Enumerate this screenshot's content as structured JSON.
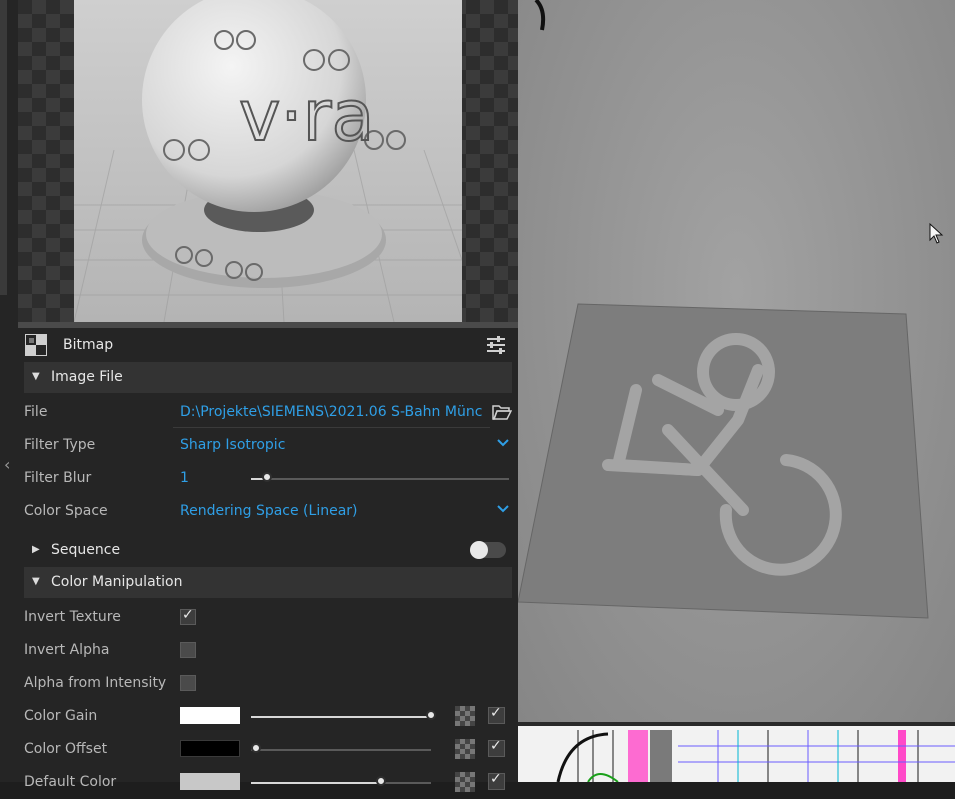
{
  "panel": {
    "title": "Bitmap",
    "sections": {
      "image_file": "Image File",
      "sequence": "Sequence",
      "color_manipulation": "Color Manipulation"
    },
    "image_file": {
      "file_label": "File",
      "file_value": "D:\\Projekte\\SIEMENS\\2021.06 S-Bahn Münc...",
      "filter_type_label": "Filter Type",
      "filter_type_value": "Sharp Isotropic",
      "filter_blur_label": "Filter Blur",
      "filter_blur_value": "1",
      "color_space_label": "Color Space",
      "color_space_value": "Rendering Space (Linear)"
    },
    "color_manipulation": {
      "invert_texture_label": "Invert Texture",
      "invert_texture": true,
      "invert_alpha_label": "Invert Alpha",
      "invert_alpha": false,
      "alpha_from_intensity_label": "Alpha from Intensity",
      "alpha_from_intensity": false,
      "color_gain_label": "Color Gain",
      "color_gain_swatch": "#ffffff",
      "color_gain_level": 1.0,
      "color_offset_label": "Color Offset",
      "color_offset_swatch": "#000000",
      "color_offset_level": 0.0,
      "default_color_label": "Default Color",
      "default_color_swatch": "#c8c8c8",
      "default_color_level": 0.7
    },
    "sequence_enabled": false
  },
  "preview": {
    "logo_text": "v·ra"
  },
  "colors": {
    "accent": "#2f9fe6",
    "panel_bg": "#252525",
    "section_bg": "#333333"
  }
}
